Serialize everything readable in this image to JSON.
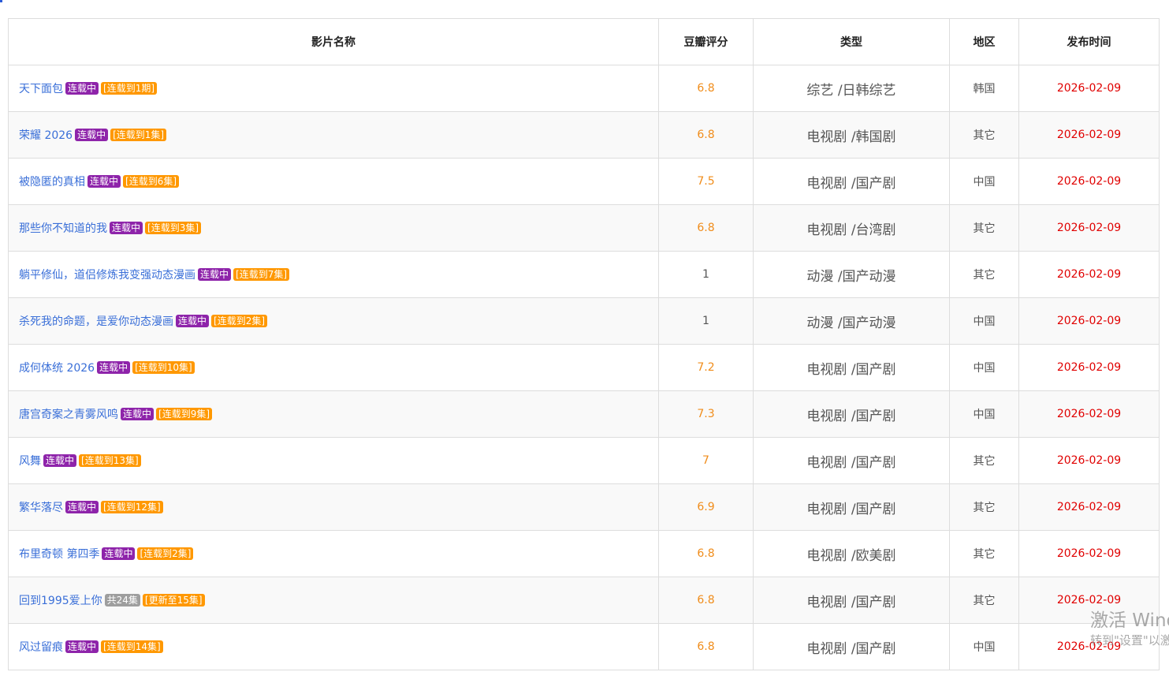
{
  "headers": {
    "name": "影片名称",
    "score": "豆瓣评分",
    "type": "类型",
    "region": "地区",
    "date": "发布时间"
  },
  "rows": [
    {
      "title": "天下面包",
      "status": "连载中",
      "update": "[连载到1期]",
      "score": "6.8",
      "type": "综艺 /日韩综艺",
      "region": "韩国",
      "date": "2026-02-09"
    },
    {
      "title": "荣耀 2026",
      "status": "连载中",
      "update": "[连载到1集]",
      "score": "6.8",
      "type": "电视剧 /韩国剧",
      "region": "其它",
      "date": "2026-02-09"
    },
    {
      "title": "被隐匿的真相",
      "status": "连载中",
      "update": "[连载到6集]",
      "score": "7.5",
      "type": "电视剧 /国产剧",
      "region": "中国",
      "date": "2026-02-09"
    },
    {
      "title": "那些你不知道的我",
      "status": "连载中",
      "update": "[连载到3集]",
      "score": "6.8",
      "type": "电视剧 /台湾剧",
      "region": "其它",
      "date": "2026-02-09"
    },
    {
      "title": "躺平修仙，道侣修炼我变强动态漫画",
      "status": "连载中",
      "update": "[连载到7集]",
      "score": "1",
      "type": "动漫 /国产动漫",
      "region": "其它",
      "date": "2026-02-09"
    },
    {
      "title": "杀死我的命题，是爱你动态漫画",
      "status": "连载中",
      "update": "[连载到2集]",
      "score": "1",
      "type": "动漫 /国产动漫",
      "region": "中国",
      "date": "2026-02-09"
    },
    {
      "title": "成何体统 2026",
      "status": "连载中",
      "update": "[连载到10集]",
      "score": "7.2",
      "type": "电视剧 /国产剧",
      "region": "中国",
      "date": "2026-02-09"
    },
    {
      "title": "唐宫奇案之青雾风鸣",
      "status": "连载中",
      "update": "[连载到9集]",
      "score": "7.3",
      "type": "电视剧 /国产剧",
      "region": "中国",
      "date": "2026-02-09"
    },
    {
      "title": "风舞",
      "status": "连载中",
      "update": "[连载到13集]",
      "score": "7",
      "type": "电视剧 /国产剧",
      "region": "其它",
      "date": "2026-02-09"
    },
    {
      "title": "繁华落尽",
      "status": "连载中",
      "update": "[连载到12集]",
      "score": "6.9",
      "type": "电视剧 /国产剧",
      "region": "其它",
      "date": "2026-02-09"
    },
    {
      "title": "布里奇顿 第四季",
      "status": "连载中",
      "update": "[连载到2集]",
      "score": "6.8",
      "type": "电视剧 /欧美剧",
      "region": "其它",
      "date": "2026-02-09"
    },
    {
      "title": "回到1995爱上你",
      "status": "共24集",
      "update": "[更新至15集]",
      "score": "6.8",
      "type": "电视剧 /国产剧",
      "region": "其它",
      "date": "2026-02-09"
    },
    {
      "title": "风过留痕",
      "status": "连载中",
      "update": "[连载到14集]",
      "score": "6.8",
      "type": "电视剧 /国产剧",
      "region": "中国",
      "date": "2026-02-09"
    }
  ],
  "watermark": {
    "line1": "激活 Windows",
    "line2": "转到\"设置\"以激活 Windows。"
  },
  "colors": {
    "title_link": "#3a6fd8",
    "status_badge": "#8e24aa",
    "total_badge": "#9e9e9e",
    "update_badge": "#ff9800",
    "score": "#f08c1a",
    "date": "#e00000"
  }
}
